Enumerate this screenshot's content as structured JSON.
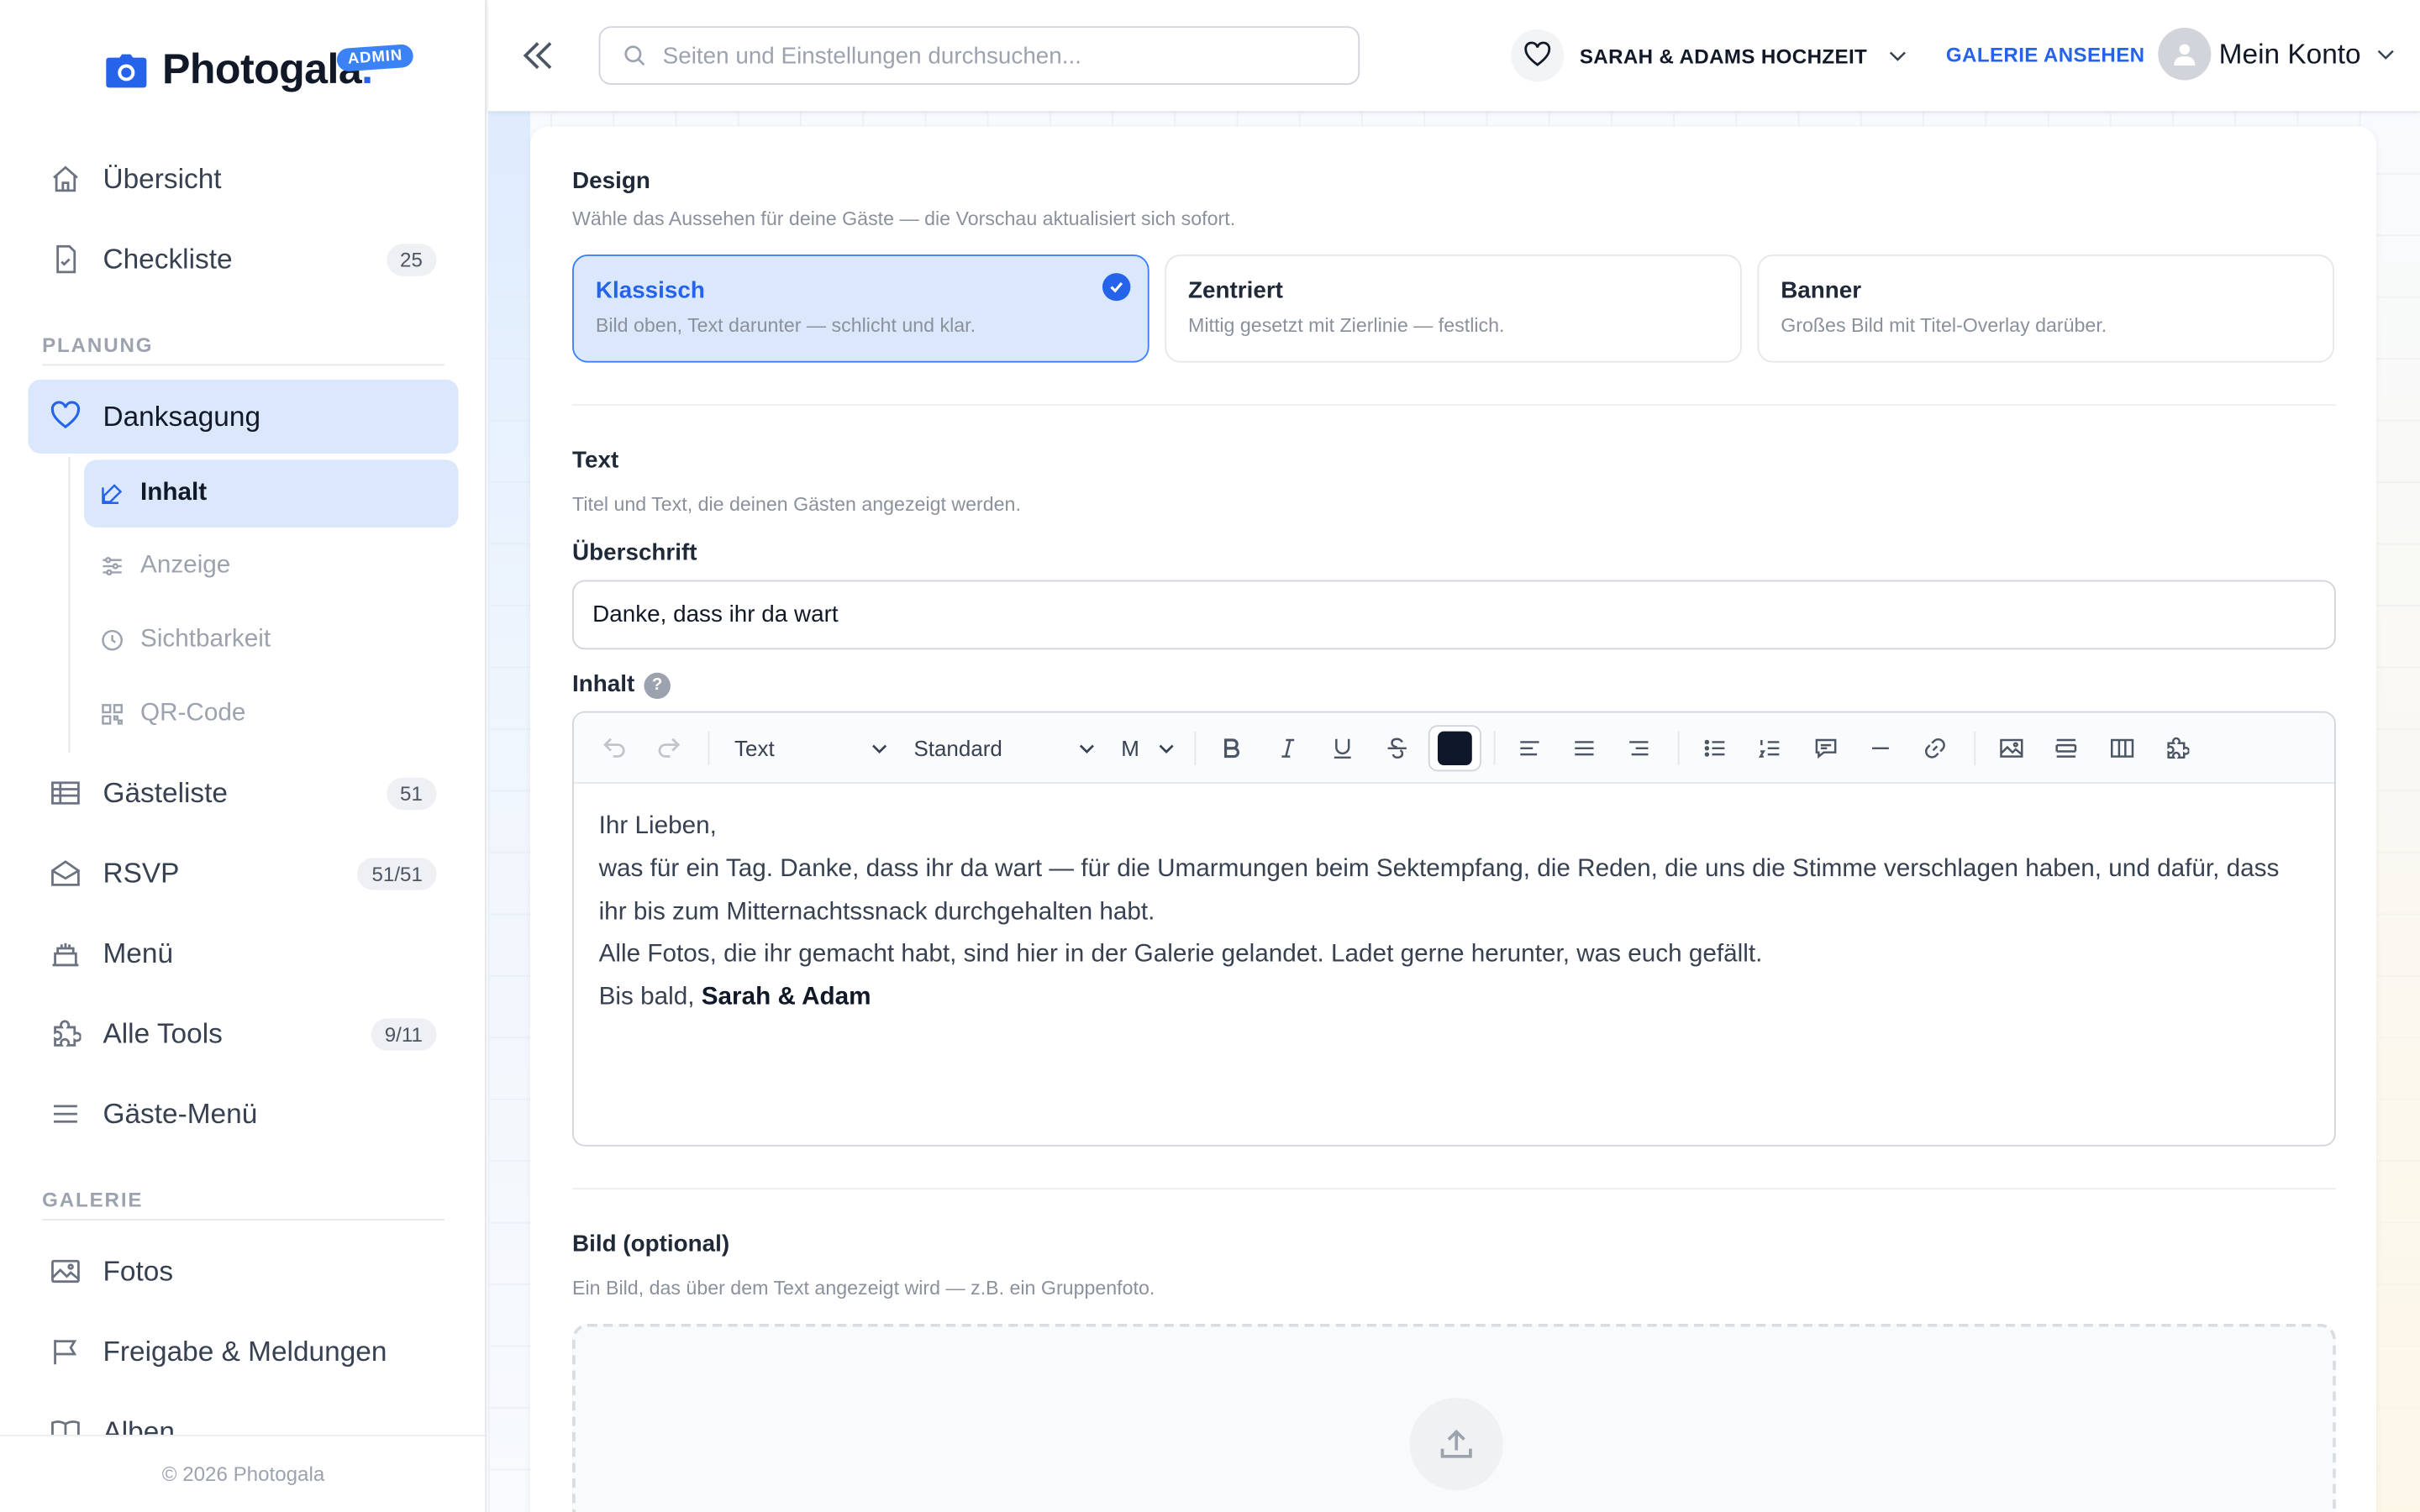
{
  "brand": {
    "name": "Photogala",
    "dot": ".",
    "badge": "ADMIN",
    "copyright": "© 2026 Photogala"
  },
  "sidebar": {
    "items_top": [
      {
        "label": "Übersicht",
        "icon": "home-icon"
      },
      {
        "label": "Checkliste",
        "icon": "checklist-icon",
        "count": "25"
      }
    ],
    "section_planning": "PLANUNG",
    "active_item": {
      "label": "Danksagung",
      "icon": "heart-icon"
    },
    "sub_items": [
      {
        "label": "Inhalt",
        "icon": "edit-icon"
      },
      {
        "label": "Anzeige",
        "icon": "sliders-icon"
      },
      {
        "label": "Sichtbarkeit",
        "icon": "clock-icon"
      },
      {
        "label": "QR-Code",
        "icon": "qr-code-icon"
      }
    ],
    "items_planning": [
      {
        "label": "Gästeliste",
        "icon": "table-icon",
        "count": "51"
      },
      {
        "label": "RSVP",
        "icon": "envelope-icon",
        "count": "51/51"
      },
      {
        "label": "Menü",
        "icon": "cake-icon"
      },
      {
        "label": "Alle Tools",
        "icon": "puzzle-icon",
        "count": "9/11"
      },
      {
        "label": "Gäste-Menü",
        "icon": "menu-icon"
      }
    ],
    "section_gallery": "GALERIE",
    "items_gallery": [
      {
        "label": "Fotos",
        "icon": "image-icon"
      },
      {
        "label": "Freigabe & Meldungen",
        "icon": "flag-icon"
      },
      {
        "label": "Alben",
        "icon": "book-icon"
      }
    ]
  },
  "topbar": {
    "search_placeholder": "Seiten und Einstellungen durchsuchen...",
    "event": "SARAH & ADAMS HOCHZEIT",
    "gallery_link": "GALERIE ANSEHEN",
    "account": "Mein Konto"
  },
  "design": {
    "title": "Design",
    "subtitle": "Wähle das Aussehen für deine Gäste — die Vorschau aktualisiert sich sofort.",
    "options": [
      {
        "title": "Klassisch",
        "desc": "Bild oben, Text darunter — schlicht und klar.",
        "selected": true
      },
      {
        "title": "Zentriert",
        "desc": "Mittig gesetzt mit Zierlinie — festlich.",
        "selected": false
      },
      {
        "title": "Banner",
        "desc": "Großes Bild mit Titel-Overlay darüber.",
        "selected": false
      }
    ]
  },
  "text_section": {
    "title": "Text",
    "subtitle": "Titel und Text, die deinen Gästen angezeigt werden.",
    "heading_label": "Überschrift",
    "heading_value": "Danke, dass ihr da wart",
    "content_label": "Inhalt",
    "help": "?"
  },
  "editor": {
    "block_type": "Text",
    "font": "Standard",
    "size": "M",
    "text_color": "#0f172a",
    "lines": [
      "Ihr Lieben,",
      "was für ein Tag. Danke, dass ihr da wart — für die Umarmungen beim Sektempfang, die Reden, die uns die Stimme verschlagen haben, und dafür, dass ihr bis zum Mitternachtssnack durchgehalten habt.",
      "Alle Fotos, die ihr gemacht habt, sind hier in der Galerie gelandet. Ladet gerne herunter, was euch gefällt."
    ],
    "closing_prefix": "Bis bald, ",
    "closing_names": "Sarah & Adam"
  },
  "image_section": {
    "title": "Bild (optional)",
    "subtitle": "Ein Bild, das über dem Text angezeigt wird — z.B. ein Gruppenfoto."
  },
  "colors": {
    "accent": "#2563eb",
    "active_bg": "#dbe8fb"
  }
}
